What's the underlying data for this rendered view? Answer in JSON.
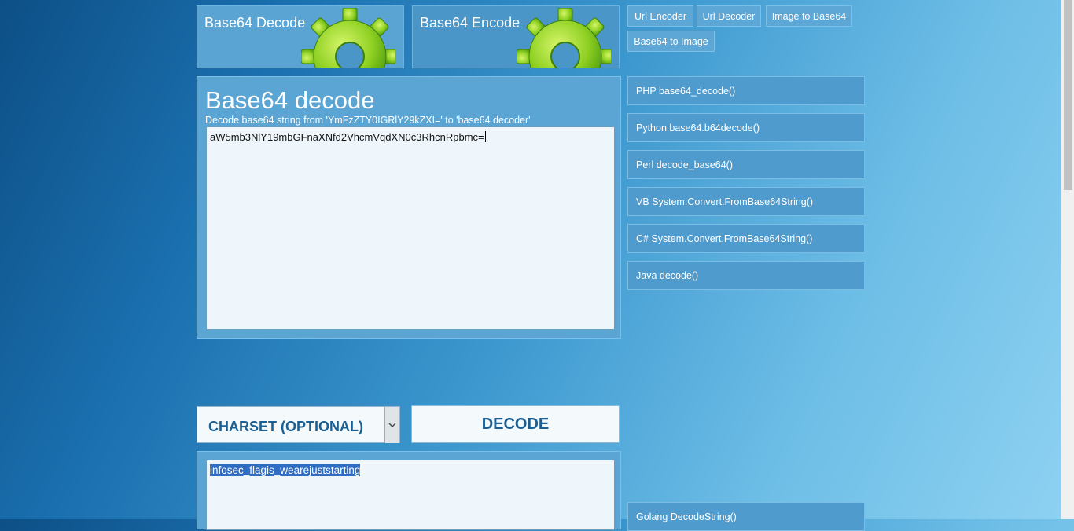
{
  "tiles": {
    "decode_title": "Base64 Decode",
    "encode_title": "Base64 Encode"
  },
  "nav": {
    "url_encoder": "Url Encoder",
    "url_decoder": "Url Decoder",
    "image_to_base64": "Image to Base64",
    "base64_to_image": "Base64 to Image"
  },
  "main": {
    "title": "Base64 decode",
    "subtitle": "Decode base64 string from 'YmFzZTY0IGRlY29kZXI=' to 'base64 decoder'",
    "input_value": "aW5mb3NlY19mbGFnaXNfd2VhcmVqdXN0c3RhcnRpbmc=",
    "charset_label": "CHARSET (OPTIONAL)",
    "decode_label": "DECODE",
    "output_value": "infosec_flagis_wearejuststarting"
  },
  "sidebar": {
    "items": [
      {
        "label": "PHP base64_decode()"
      },
      {
        "label": "Python base64.b64decode()"
      },
      {
        "label": "Perl decode_base64()"
      },
      {
        "label": "VB System.Convert.FromBase64String()"
      },
      {
        "label": "C# System.Convert.FromBase64String()"
      },
      {
        "label": "Java decode()"
      },
      {
        "label": "Golang DecodeString()"
      }
    ]
  },
  "colors": {
    "tile": "#4a96c9",
    "panel": "#5aa5d4",
    "accent_text": "#1b5f93",
    "selection": "#2e6dc2"
  },
  "icons": [
    "gear-icon",
    "chevron-down-icon"
  ]
}
